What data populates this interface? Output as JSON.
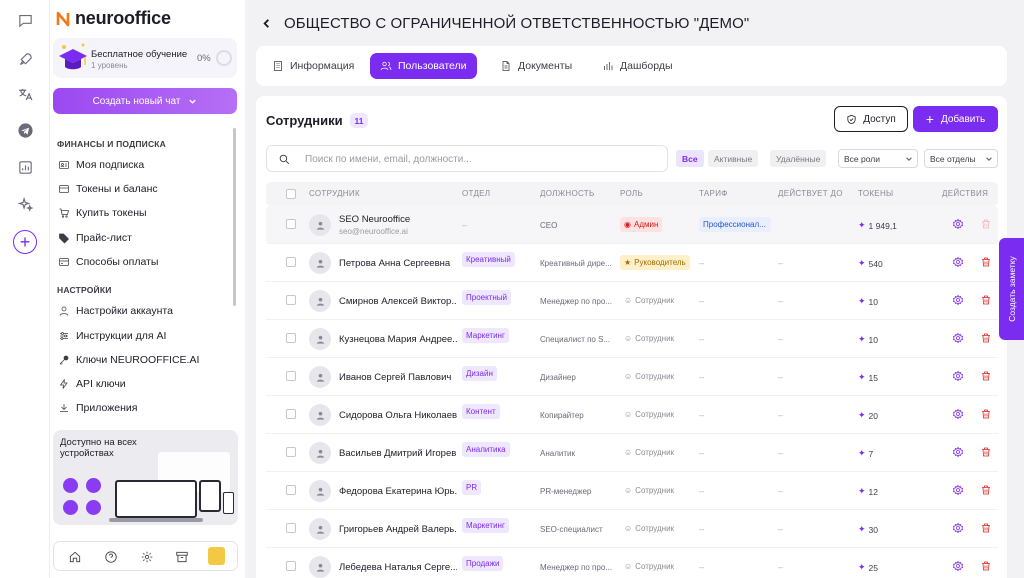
{
  "app": {
    "logo_text": "neurooffice"
  },
  "promo": {
    "title": "Бесплатное обучение",
    "subtitle": "1 уровень",
    "percent": "0%"
  },
  "sidebar": {
    "new_chat_label": "Создать новый чат",
    "sections": [
      {
        "title": "ФИНАНСЫ И ПОДПИСКА",
        "items": [
          {
            "label": "Моя подписка",
            "icon": "id-card-icon"
          },
          {
            "label": "Токены и баланс",
            "icon": "coins-icon"
          },
          {
            "label": "Купить токены",
            "icon": "cart-icon"
          },
          {
            "label": "Прайс-лист",
            "icon": "tag-icon"
          },
          {
            "label": "Способы оплаты",
            "icon": "credit-card-icon"
          }
        ]
      },
      {
        "title": "НАСТРОЙКИ",
        "items": [
          {
            "label": "Настройки аккаунта",
            "icon": "user-icon"
          },
          {
            "label": "Инструкции для AI",
            "icon": "sliders-icon"
          },
          {
            "label": "Ключи NEUROOFFICE.AI",
            "icon": "key-icon"
          },
          {
            "label": "API ключи",
            "icon": "bolt-icon"
          },
          {
            "label": "Приложения",
            "icon": "download-icon"
          }
        ]
      }
    ],
    "devices_title": "Доступно на всех устройствах"
  },
  "header": {
    "title": "ОБЩЕСТВО С ОГРАНИЧЕННОЙ ОТВЕТСТВЕННОСТЬЮ \"ДЕМО\""
  },
  "tabs": [
    {
      "label": "Информация",
      "icon": "building-icon",
      "active": false
    },
    {
      "label": "Пользователи",
      "icon": "users-icon",
      "active": true
    },
    {
      "label": "Документы",
      "icon": "document-icon",
      "active": false
    },
    {
      "label": "Дашборды",
      "icon": "bar-chart-icon",
      "active": false
    }
  ],
  "employees": {
    "title": "Сотрудники",
    "count": "11",
    "access_label": "Доступ",
    "add_label": "Добавить",
    "search_placeholder": "Поиск по имени, email, должности...",
    "filters": [
      "Все",
      "Активные",
      "Удалённые"
    ],
    "roles_select": "Все роли",
    "depts_select": "Все отделы",
    "columns": [
      "СОТРУДНИК",
      "ОТДЕЛ",
      "ДОЛЖНОСТЬ",
      "РОЛЬ",
      "ТАРИФ",
      "ДЕЙСТВУЕТ ДО",
      "ТОКЕНЫ",
      "ДЕЙСТВИЯ"
    ],
    "rows": [
      {
        "name": "SEO Neurooffice",
        "email": "seo@neurooffice.ai",
        "dept": "–",
        "position": "CEO",
        "role": "Админ",
        "role_type": "admin",
        "tariff": "Профессионал...",
        "valid_until": "",
        "tokens": "1 949,1",
        "deletable": false
      },
      {
        "name": "Петрова Анна Сергеевна",
        "email": "",
        "dept": "Креативный",
        "position": "Креативный дире...",
        "role": "Руководитель",
        "role_type": "lead",
        "tariff": "–",
        "valid_until": "–",
        "tokens": "540",
        "deletable": true
      },
      {
        "name": "Смирнов Алексей Виктор...",
        "email": "",
        "dept": "Проектный",
        "position": "Менеджер по про...",
        "role": "Сотрудник",
        "role_type": "member",
        "tariff": "–",
        "valid_until": "–",
        "tokens": "10",
        "deletable": true
      },
      {
        "name": "Кузнецова Мария Андрее...",
        "email": "",
        "dept": "Маркетинг",
        "position": "Специалист по S...",
        "role": "Сотрудник",
        "role_type": "member",
        "tariff": "–",
        "valid_until": "–",
        "tokens": "10",
        "deletable": true
      },
      {
        "name": "Иванов Сергей Павлович",
        "email": "",
        "dept": "Дизайн",
        "position": "Дизайнер",
        "role": "Сотрудник",
        "role_type": "member",
        "tariff": "–",
        "valid_until": "–",
        "tokens": "15",
        "deletable": true
      },
      {
        "name": "Сидорова Ольга Николаев...",
        "email": "",
        "dept": "Контент",
        "position": "Копирайтер",
        "role": "Сотрудник",
        "role_type": "member",
        "tariff": "–",
        "valid_until": "–",
        "tokens": "20",
        "deletable": true
      },
      {
        "name": "Васильев Дмитрий Игорев...",
        "email": "",
        "dept": "Аналитика",
        "position": "Аналитик",
        "role": "Сотрудник",
        "role_type": "member",
        "tariff": "–",
        "valid_until": "–",
        "tokens": "7",
        "deletable": true
      },
      {
        "name": "Федорова Екатерина Юрь...",
        "email": "",
        "dept": "PR",
        "position": "PR-менеджер",
        "role": "Сотрудник",
        "role_type": "member",
        "tariff": "–",
        "valid_until": "–",
        "tokens": "12",
        "deletable": true
      },
      {
        "name": "Григорьев Андрей Валерь...",
        "email": "",
        "dept": "Маркетинг",
        "position": "SEO-специалист",
        "role": "Сотрудник",
        "role_type": "member",
        "tariff": "–",
        "valid_until": "–",
        "tokens": "30",
        "deletable": true
      },
      {
        "name": "Лебедева Наталья Серге...",
        "email": "",
        "dept": "Продажи",
        "position": "Менеджер по про...",
        "role": "Сотрудник",
        "role_type": "member",
        "tariff": "–",
        "valid_until": "–",
        "tokens": "25",
        "deletable": true
      }
    ]
  },
  "feedback_tab": "Создать заметку",
  "colors": {
    "accent": "#7a2cf0",
    "danger": "#e02424"
  }
}
